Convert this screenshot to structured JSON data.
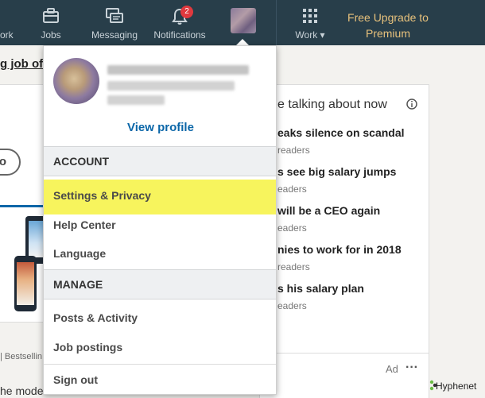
{
  "nav": {
    "items": [
      {
        "label": "ork"
      },
      {
        "label": "Jobs"
      },
      {
        "label": "Messaging"
      },
      {
        "label": "Notifications",
        "badge": "2"
      },
      {
        "label": "Work ▾"
      }
    ],
    "premium": "Free Upgrade to Premium"
  },
  "background": {
    "headline": "g job of",
    "button_label": "o",
    "bestselling": "| Bestsellin",
    "bottom_text": "he mode",
    "news": {
      "heading": "e talking about now",
      "stories": [
        {
          "title": "eaks silence on scandal",
          "readers": "readers"
        },
        {
          "title": "s see big salary jumps",
          "readers": "eaders"
        },
        {
          "title": "will be a CEO again",
          "readers": "eaders"
        },
        {
          "title": "nies to work for in 2018",
          "readers": "readers"
        },
        {
          "title": "s his salary plan",
          "readers": "eaders"
        }
      ],
      "ad_label": "Ad",
      "more": "···"
    }
  },
  "dropdown": {
    "view_profile": "View profile",
    "account_header": "ACCOUNT",
    "account_items": [
      "Settings & Privacy",
      "Help Center",
      "Language"
    ],
    "manage_header": "MANAGE",
    "manage_items": [
      "Posts & Activity",
      "Job postings"
    ],
    "sign_out": "Sign out"
  },
  "watermark": "Hyphenet",
  "colors": {
    "nav_bg": "#283e4a",
    "highlight": "#f7f45d",
    "link": "#0a66a8",
    "premium": "#e7c17c",
    "badge": "#e0393e"
  }
}
